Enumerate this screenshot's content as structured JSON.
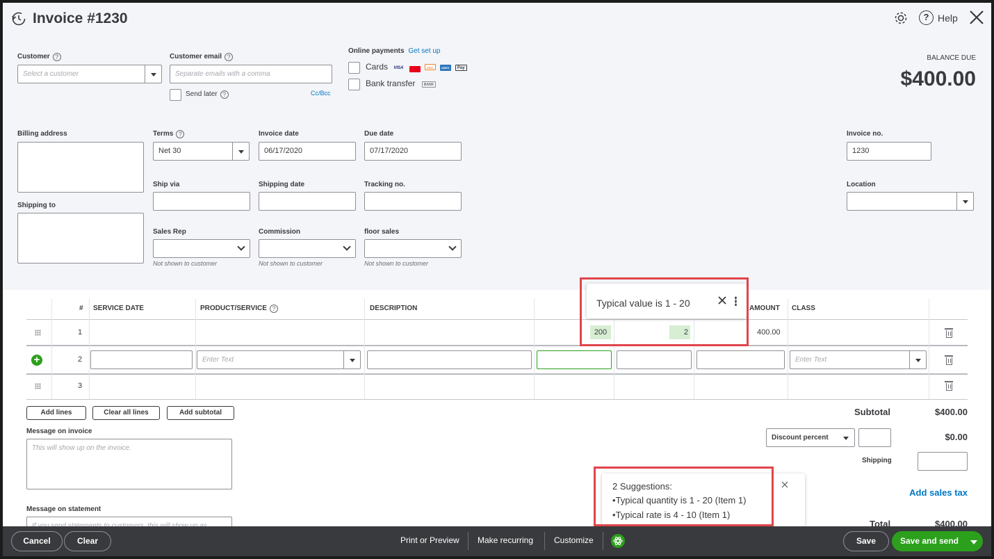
{
  "header": {
    "title": "Invoice #1230",
    "help_label": "Help"
  },
  "customer": {
    "label": "Customer",
    "placeholder": "Select a customer",
    "email_label": "Customer email",
    "email_placeholder": "Separate emails with a comma",
    "send_later_label": "Send later",
    "ccbcc_label": "Cc/Bcc"
  },
  "payments": {
    "label": "Online payments",
    "setup_link": "Get set up",
    "cards_label": "Cards",
    "card_brands": [
      "VISA",
      "MC",
      "DISC",
      "AMEX",
      "Pay"
    ],
    "bank_label": "Bank transfer",
    "bank_badge": "BANK"
  },
  "balance": {
    "label": "BALANCE DUE",
    "amount": "$400.00"
  },
  "fields": {
    "billing_address_label": "Billing address",
    "shipping_to_label": "Shipping to",
    "terms_label": "Terms",
    "terms_value": "Net 30",
    "invoice_date_label": "Invoice date",
    "invoice_date_value": "06/17/2020",
    "due_date_label": "Due date",
    "due_date_value": "07/17/2020",
    "invoice_no_label": "Invoice no.",
    "invoice_no_value": "1230",
    "ship_via_label": "Ship via",
    "shipping_date_label": "Shipping date",
    "tracking_no_label": "Tracking no.",
    "location_label": "Location",
    "sales_rep_label": "Sales Rep",
    "commission_label": "Commission",
    "floor_sales_label": "floor sales",
    "not_shown_note": "Not shown to customer"
  },
  "table": {
    "headers": {
      "num": "#",
      "service_date": "SERVICE DATE",
      "product": "PRODUCT/SERVICE",
      "description": "DESCRIPTION",
      "amount": "AMOUNT",
      "class": "CLASS"
    },
    "rows": [
      {
        "num": "1",
        "qty": "200",
        "rate": "2",
        "amount": "400.00"
      },
      {
        "num": "2",
        "product_placeholder": "Enter Text",
        "class_placeholder": "Enter Text"
      },
      {
        "num": "3"
      }
    ],
    "tooltip": "Typical value is 1 - 20"
  },
  "actions": {
    "add_lines": "Add lines",
    "clear_all_lines": "Clear all lines",
    "add_subtotal": "Add subtotal"
  },
  "messages": {
    "invoice_label": "Message on invoice",
    "invoice_placeholder": "This will show up on the invoice.",
    "statement_label": "Message on statement",
    "statement_placeholder": "If you send statements to customers, this will show up as"
  },
  "totals": {
    "subtotal_label": "Subtotal",
    "subtotal_value": "$400.00",
    "discount_label": "Discount percent",
    "discount_value": "$0.00",
    "shipping_label": "Shipping",
    "add_sales_tax": "Add sales tax",
    "total_label": "Total",
    "total_value": "$400.00"
  },
  "suggestions": {
    "title": "2 Suggestions:",
    "items": [
      "Typical quantity is 1 - 20 (Item 1)",
      "Typical rate is 4 - 10 (Item 1)"
    ]
  },
  "footer": {
    "cancel": "Cancel",
    "clear": "Clear",
    "print_preview": "Print or Preview",
    "make_recurring": "Make recurring",
    "customize": "Customize",
    "save": "Save",
    "save_and_send": "Save and send"
  },
  "colors": {
    "green": "#2ca01c",
    "link_blue": "#0077c5",
    "highlight_red": "#e0454b",
    "footer_bg": "#393a3d"
  }
}
